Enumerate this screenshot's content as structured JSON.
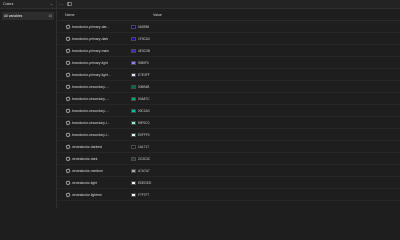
{
  "toolbar": {
    "collection_name": "Colors",
    "more_label": "···"
  },
  "sidebar": {
    "group_label": "All variables",
    "group_count": "16"
  },
  "table": {
    "col_name": "Name",
    "col_value": "Value",
    "rows": [
      {
        "name": "brandcolor-primary-dar...",
        "hex": "0A0958",
        "color": "#0A0958"
      },
      {
        "name": "brandcolor-primary-dark",
        "hex": "1F0CA3",
        "color": "#1F0CA3"
      },
      {
        "name": "brandcolor-primary-main",
        "hex": "4E3C0B",
        "color": "#3A2FB8"
      },
      {
        "name": "brandcolor-primary-light",
        "hex": "9080F0",
        "color": "#9080F0"
      },
      {
        "name": "brandcolor-primary-light...",
        "hex": "E7E3FF",
        "color": "#E7E3FF"
      },
      {
        "name": "brandcolor-secondary-...",
        "hex": "006B4B",
        "color": "#006B4B"
      },
      {
        "name": "brandcolor-secondary-...",
        "hex": "00A87C",
        "color": "#00A87C"
      },
      {
        "name": "brandcolor-secondary-...",
        "hex": "00C2A0",
        "color": "#00C2A0"
      },
      {
        "name": "brandcolor-secondary-l...",
        "hex": "90F0C0",
        "color": "#90F0C0"
      },
      {
        "name": "brandcolor-secondary-l...",
        "hex": "E0FFF0",
        "color": "#E0FFF0"
      },
      {
        "name": "neutralcolor-darkest",
        "hex": "1A1717",
        "color": "#1A1717"
      },
      {
        "name": "neutralcolor-dark",
        "hex": "2C3C3C",
        "color": "#2C3C3C"
      },
      {
        "name": "neutralcolor-medium",
        "hex": "A7A7A7",
        "color": "#A7A7A7"
      },
      {
        "name": "neutralcolor-light",
        "hex": "EDEDED",
        "color": "#EDEDED"
      },
      {
        "name": "neutralcolor-lightest",
        "hex": "F7F7F7",
        "color": "#F7F7F7"
      }
    ]
  }
}
